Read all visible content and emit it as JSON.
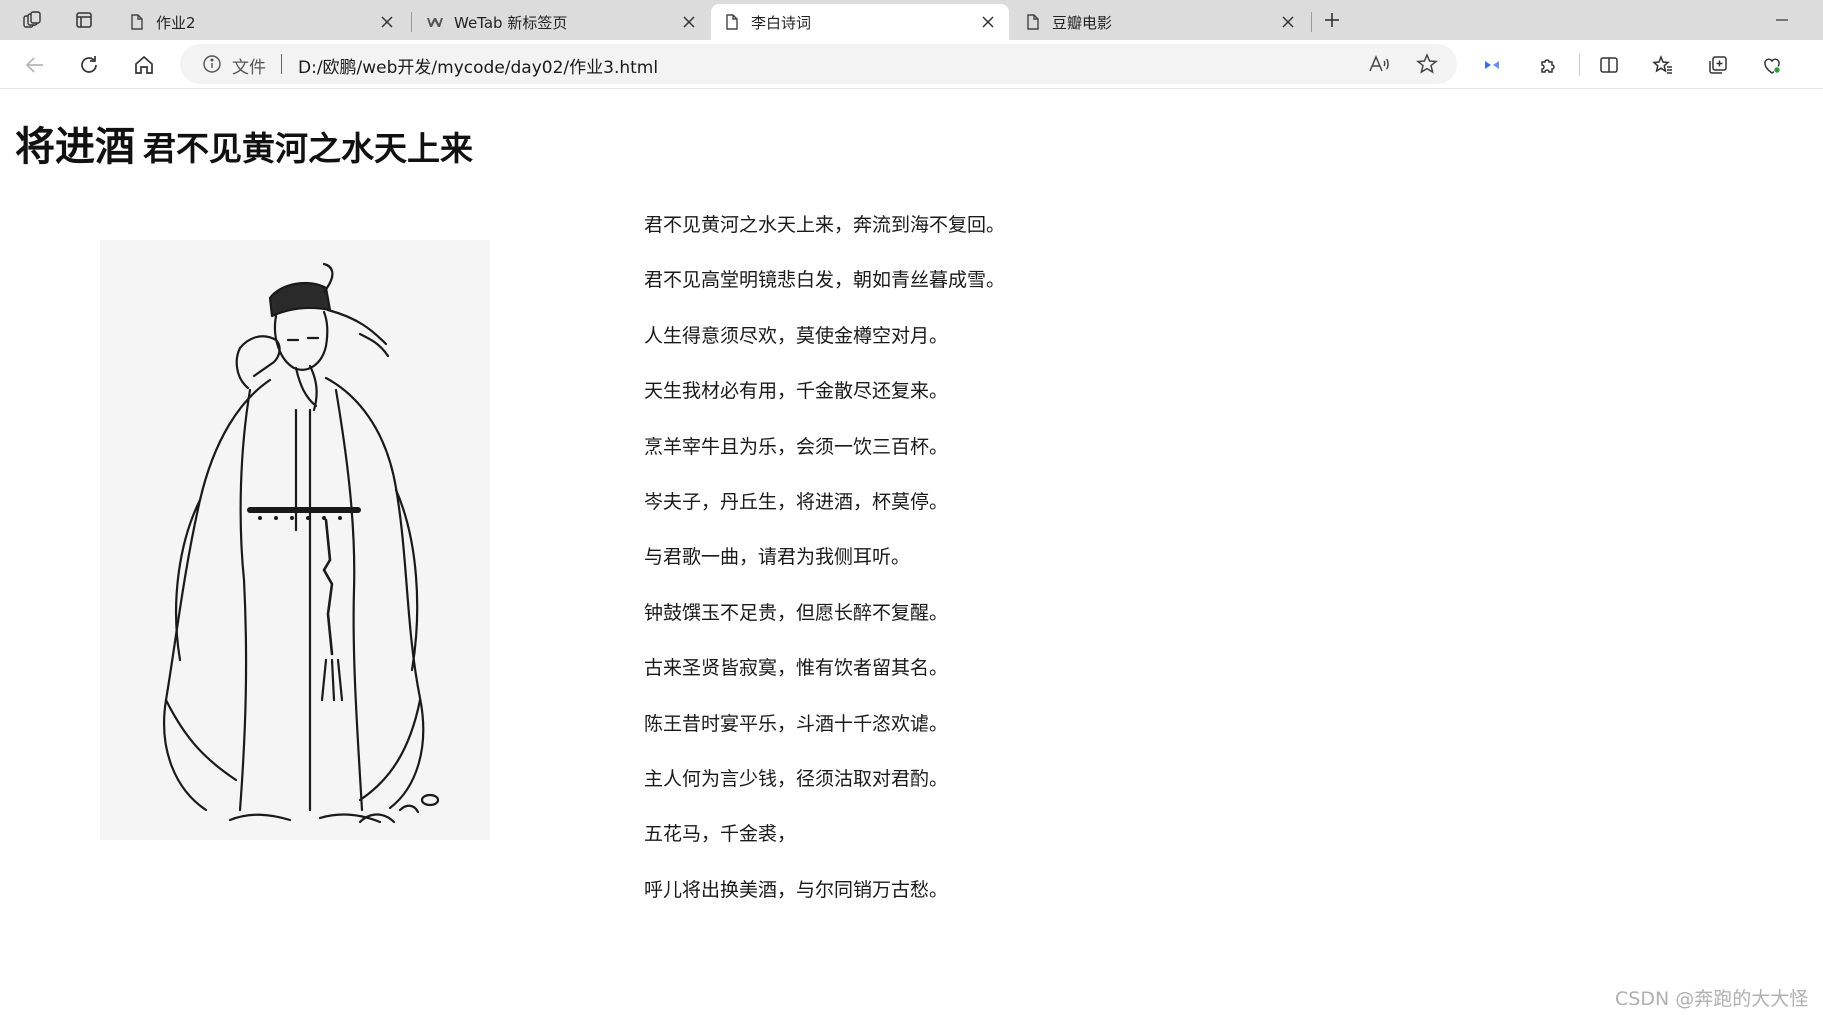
{
  "tabs": [
    {
      "title": "作业2",
      "icon": "document-icon"
    },
    {
      "title": "WeTab 新标签页",
      "icon": "wetab-icon"
    },
    {
      "title": "李白诗词",
      "icon": "document-icon",
      "active": true
    },
    {
      "title": "豆瓣电影",
      "icon": "document-icon"
    }
  ],
  "toolbar": {
    "file_label": "文件",
    "url": "D:/欧鹏/web开发/mycode/day02/作业3.html"
  },
  "page": {
    "title_main": "将进酒",
    "title_sub": "君不见黄河之水天上来",
    "poem_lines": [
      "君不见黄河之水天上来，奔流到海不复回。",
      "君不见高堂明镜悲白发，朝如青丝暮成雪。",
      "人生得意须尽欢，莫使金樽空对月。",
      "天生我材必有用，千金散尽还复来。",
      "烹羊宰牛且为乐，会须一饮三百杯。",
      "岑夫子，丹丘生，将进酒，杯莫停。",
      "与君歌一曲，请君为我侧耳听。",
      "钟鼓馔玉不足贵，但愿长醉不复醒。",
      "古来圣贤皆寂寞，惟有饮者留其名。",
      "陈王昔时宴平乐，斗酒十千恣欢谑。",
      "主人何为言少钱，径须沽取对君酌。",
      "五花马，千金裘，",
      "呼儿将出换美酒，与尔同销万古愁。"
    ]
  },
  "watermark": "CSDN @奔跑的大大怪",
  "colors": {
    "tabstrip_bg": "#dcdcdc",
    "active_tab_bg": "#ffffff",
    "addressbar_bg": "#f3f3f3",
    "copilot_accent": "#3a6df0",
    "shield_accent": "#2e9e44"
  }
}
